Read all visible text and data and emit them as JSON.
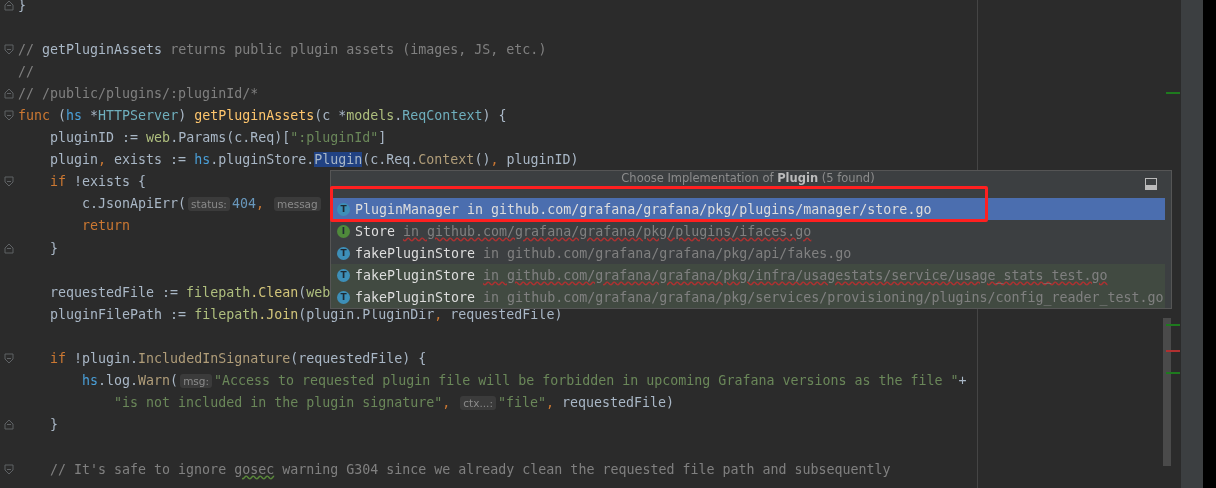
{
  "editor": {
    "lines": [
      {
        "kind": "fold_end",
        "segments": [
          {
            "kind": "plain",
            "text": "}"
          }
        ]
      },
      {
        "kind": "code"
      },
      {
        "kind": "fold_start",
        "segments": [
          {
            "kind": "comment",
            "text": "// "
          },
          {
            "kind": "comment_ref",
            "text": "getPluginAssets"
          },
          {
            "kind": "comment",
            "text": " returns public plugin assets (images, JS, etc.)"
          }
        ]
      },
      {
        "kind": "code",
        "segments": [
          {
            "kind": "comment",
            "text": "//"
          }
        ]
      },
      {
        "kind": "fold_end",
        "segments": [
          {
            "kind": "comment",
            "text": "// /public/plugins/:pluginId/*"
          }
        ]
      },
      {
        "kind": "fold_start",
        "segments": [
          {
            "kind": "keyword",
            "text": "func"
          },
          {
            "kind": "plain",
            "text": " ("
          },
          {
            "kind": "receiver",
            "text": "hs"
          },
          {
            "kind": "plain",
            "text": " *"
          },
          {
            "kind": "type",
            "text": "HTTPServer"
          },
          {
            "kind": "plain",
            "text": ") "
          },
          {
            "kind": "function",
            "text": "getPluginAssets"
          },
          {
            "kind": "plain",
            "text": "(c *"
          },
          {
            "kind": "package",
            "text": "models"
          },
          {
            "kind": "plain",
            "text": "."
          },
          {
            "kind": "type",
            "text": "ReqContext"
          },
          {
            "kind": "plain",
            "text": ") {"
          }
        ],
        "children": [
          {
            "kind": "code",
            "segments": [
              {
                "kind": "plain",
                "text": "pluginID := "
              },
              {
                "kind": "package",
                "text": "web"
              },
              {
                "kind": "plain",
                "text": ".Params(c.Req)["
              },
              {
                "kind": "string",
                "text": "\":pluginId\""
              },
              {
                "kind": "plain",
                "text": "]"
              }
            ]
          },
          {
            "kind": "code",
            "segments": [
              {
                "kind": "plain",
                "text": "plugin"
              },
              {
                "kind": "keyword",
                "text": ", "
              },
              {
                "kind": "plain",
                "text": "exists := "
              },
              {
                "kind": "receiver",
                "text": "hs"
              },
              {
                "kind": "plain",
                "text": ".pluginStore."
              },
              {
                "kind": "selected",
                "text": "Plugin"
              },
              {
                "kind": "plain",
                "text": "(c.Req."
              },
              {
                "kind": "method",
                "text": "Context"
              },
              {
                "kind": "plain",
                "text": "()"
              },
              {
                "kind": "keyword",
                "text": ", "
              },
              {
                "kind": "plain",
                "text": "pluginID)"
              }
            ]
          },
          {
            "kind": "fold_start",
            "segments": [
              {
                "kind": "keyword",
                "text": "if"
              },
              {
                "kind": "plain",
                "text": " !exists {"
              }
            ],
            "children": [
              {
                "kind": "code",
                "segments": [
                  {
                    "kind": "plain",
                    "text": "c.JsonApiErr("
                  },
                  {
                    "kind": "hint",
                    "text": "status:"
                  },
                  {
                    "kind": "number",
                    "text": "404"
                  },
                  {
                    "kind": "keyword",
                    "text": ", "
                  },
                  {
                    "kind": "hint",
                    "text": "messag"
                  }
                ]
              },
              {
                "kind": "code",
                "segments": [
                  {
                    "kind": "keyword",
                    "text": "return"
                  }
                ]
              }
            ]
          },
          {
            "kind": "fold_end",
            "segments": [
              {
                "kind": "plain",
                "text": "}"
              }
            ]
          },
          {
            "kind": "code"
          },
          {
            "kind": "code",
            "segments": [
              {
                "kind": "plain",
                "text": "requestedFile := "
              },
              {
                "kind": "package",
                "text": "filepath"
              },
              {
                "kind": "call",
                "text": ".Clean"
              },
              {
                "kind": "plain",
                "text": "("
              },
              {
                "kind": "package",
                "text": "web"
              }
            ]
          },
          {
            "kind": "code",
            "segments": [
              {
                "kind": "plain",
                "text": "pluginFilePath := "
              },
              {
                "kind": "package",
                "text": "filepath"
              },
              {
                "kind": "call",
                "text": ".Join"
              },
              {
                "kind": "plain",
                "text": "(plugin.PluginDir"
              },
              {
                "kind": "keyword",
                "text": ", "
              },
              {
                "kind": "plain",
                "text": "requestedFile)"
              }
            ]
          },
          {
            "kind": "code"
          },
          {
            "kind": "fold_start",
            "segments": [
              {
                "kind": "keyword",
                "text": "if"
              },
              {
                "kind": "plain",
                "text": " !plugin."
              },
              {
                "kind": "method",
                "text": "IncludedInSignature"
              },
              {
                "kind": "plain",
                "text": "(requestedFile) {"
              }
            ],
            "children": [
              {
                "kind": "code",
                "segments": [
                  {
                    "kind": "receiver",
                    "text": "hs"
                  },
                  {
                    "kind": "plain",
                    "text": ".log."
                  },
                  {
                    "kind": "method",
                    "text": "Warn"
                  },
                  {
                    "kind": "plain",
                    "text": "("
                  },
                  {
                    "kind": "hint",
                    "text": "msg:"
                  },
                  {
                    "kind": "string",
                    "text": "\"Access to requested plugin file will be forbidden in upcoming Grafana versions as the file \""
                  },
                  {
                    "kind": "plain",
                    "text": "+"
                  }
                ],
                "children": [
                  {
                    "kind": "code",
                    "segments": [
                      {
                        "kind": "string",
                        "text": "\"is not included in the plugin signature\""
                      },
                      {
                        "kind": "keyword",
                        "text": ", "
                      },
                      {
                        "kind": "hint",
                        "text": "ctx...:"
                      },
                      {
                        "kind": "string",
                        "text": "\"file\""
                      },
                      {
                        "kind": "keyword",
                        "text": ", "
                      },
                      {
                        "kind": "plain",
                        "text": "requestedFile)"
                      }
                    ]
                  }
                ]
              }
            ]
          },
          {
            "kind": "fold_end",
            "segments": [
              {
                "kind": "plain",
                "text": "}"
              }
            ]
          },
          {
            "kind": "code"
          },
          {
            "kind": "fold_start",
            "segments": [
              {
                "kind": "comment",
                "text": "// It's safe to ignore "
              },
              {
                "kind": "comment_typo",
                "text": "gosec"
              },
              {
                "kind": "comment",
                "text": " warning G304 since we already clean the requested file path and subsequently"
              }
            ]
          }
        ]
      }
    ]
  },
  "popup": {
    "title": "Choose Implementation of **Plugin** (5 found)",
    "items": [
      {
        "icon_letter": "T",
        "color": "#3d8fb8",
        "name": "PluginManager",
        "location": "in github.com/grafana/grafana/pkg/plugins/manager/store.go",
        "selected": true,
        "kind": "source",
        "flagged": false
      },
      {
        "icon_letter": "I",
        "color": "#4f8a3b",
        "name": "Store",
        "location": "in github.com/grafana/grafana/pkg/plugins/ifaces.go",
        "selected": false,
        "kind": "source",
        "flagged": true
      },
      {
        "icon_letter": "T",
        "color": "#3d8fb8",
        "name": "fakePluginStore",
        "location": "in github.com/grafana/grafana/pkg/api/fakes.go",
        "selected": false,
        "kind": "source",
        "flagged": false
      },
      {
        "icon_letter": "T",
        "color": "#3d8fb8",
        "name": "fakePluginStore",
        "location": "in github.com/grafana/grafana/pkg/infra/usagestats/service/usage_stats_test.go",
        "selected": false,
        "kind": "test",
        "flagged": true
      },
      {
        "icon_letter": "T",
        "color": "#3d8fb8",
        "name": "fakePluginStore",
        "location": "in github.com/grafana/grafana/pkg/services/provisioning/plugins/config_reader_test.go",
        "selected": false,
        "kind": "test",
        "flagged": false
      }
    ]
  }
}
